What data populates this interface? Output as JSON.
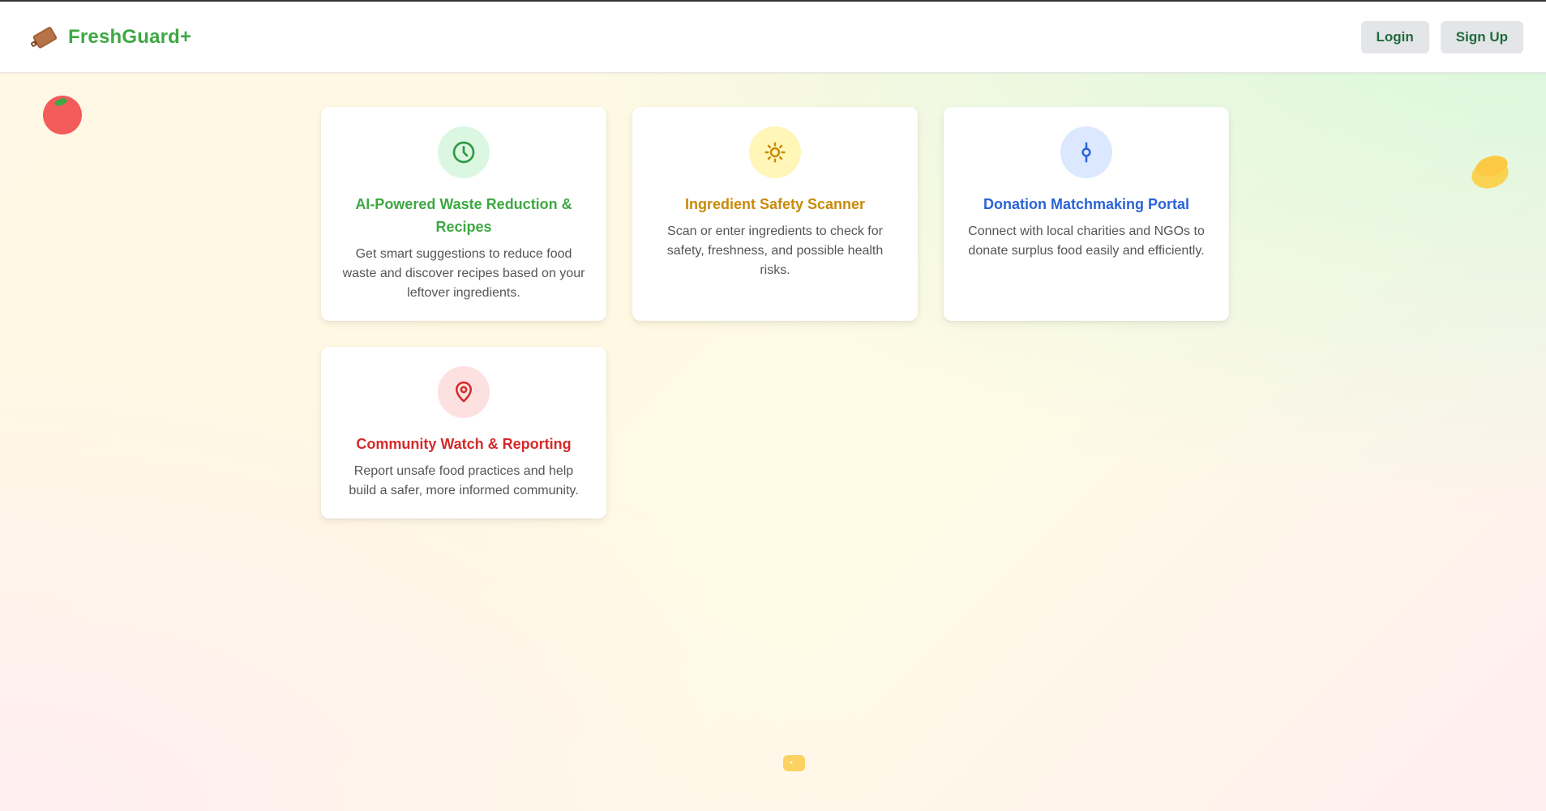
{
  "header": {
    "brand": "FreshGuard+",
    "login_label": "Login",
    "signup_label": "Sign Up",
    "brand_color": "#3ea843"
  },
  "features": [
    {
      "title": "AI-Powered Waste Reduction & Recipes",
      "description": "Get smart suggestions to reduce food waste and discover recipes based on your leftover ingredients.",
      "icon": "clock-icon",
      "accent": "#3ea843",
      "icon_bg": "#dcf7e1"
    },
    {
      "title": "Ingredient Safety Scanner",
      "description": "Scan or enter ingredients to check for safety, freshness, and possible health risks.",
      "icon": "sun-icon",
      "accent": "#c98a0b",
      "icon_bg": "#fff6b8"
    },
    {
      "title": "Donation Matchmaking Portal",
      "description": "Connect with local charities and NGOs to donate surplus food easily and efficiently.",
      "icon": "connector-icon",
      "accent": "#2b63d6",
      "icon_bg": "#dbe8ff"
    },
    {
      "title": "Community Watch & Reporting",
      "description": "Report unsafe food practices and help build a safer, more informed community.",
      "icon": "map-pin-icon",
      "accent": "#d42a2a",
      "icon_bg": "#fde0e0"
    }
  ]
}
